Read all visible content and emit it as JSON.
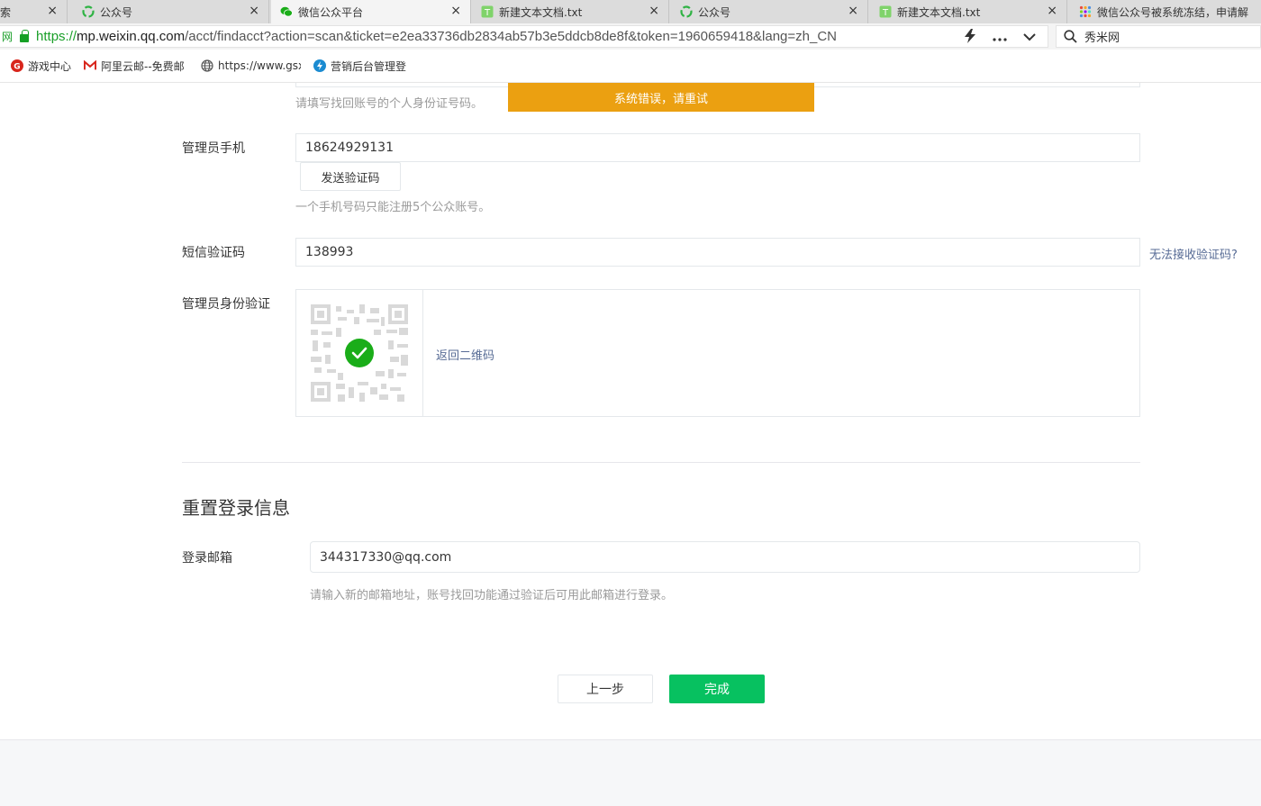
{
  "browser": {
    "tabs": [
      {
        "title": "索",
        "icon": "search-tab-icon",
        "active": false
      },
      {
        "title": "公众号",
        "icon": "wechat-mp-icon",
        "active": false
      },
      {
        "title": "微信公众平台",
        "icon": "wechat-icon",
        "active": true
      },
      {
        "title": "新建文本文档.txt",
        "icon": "text-file-icon",
        "active": false
      },
      {
        "title": "公众号",
        "icon": "wechat-mp-icon",
        "active": false
      },
      {
        "title": "新建文本文档.txt",
        "icon": "text-file-icon",
        "active": false
      },
      {
        "title": "微信公众号被系统冻结，申请解",
        "icon": "apps-grid-icon",
        "active": false
      }
    ],
    "close_glyph": "×",
    "address": {
      "prefix": "网",
      "scheme": "https://",
      "host": "mp.weixin.qq.com",
      "path": "/acct/findacct?action=scan&ticket=e2ea33736db2834ab57b3e5ddcb8de8f&token=1960659418&lang=zh_CN"
    },
    "search_text": "秀米网",
    "bookmarks": [
      {
        "label": "游戏中心",
        "icon": "game-center-icon"
      },
      {
        "label": "阿里云邮--免费邮",
        "icon": "aliyun-mail-icon"
      },
      {
        "label": "https://www.gsx",
        "icon": "globe-icon"
      },
      {
        "label": "营销后台管理登",
        "icon": "marketing-admin-icon"
      }
    ]
  },
  "page": {
    "toast": "系统错误，请重试",
    "id_hint": "请填写找回账号的个人身份证号码。",
    "phone": {
      "label": "管理员手机",
      "value": "18624929131",
      "send_code_button": "发送验证码",
      "hint": "一个手机号码只能注册5个公众账号。"
    },
    "sms": {
      "label": "短信验证码",
      "value": "138993",
      "cant_receive_link": "无法接收验证码?"
    },
    "identity": {
      "label": "管理员身份验证",
      "back_to_qr_link": "返回二维码"
    },
    "reset_section": {
      "title": "重置登录信息",
      "email_label": "登录邮箱",
      "email_value": "344317330@qq.com",
      "email_hint": "请输入新的邮箱地址，账号找回功能通过验证后可用此邮箱进行登录。"
    },
    "buttons": {
      "prev": "上一步",
      "done": "完成"
    },
    "colors": {
      "toast": "#eba011",
      "primary": "#07c160",
      "link": "#576b95",
      "check": "#1aad19"
    }
  }
}
